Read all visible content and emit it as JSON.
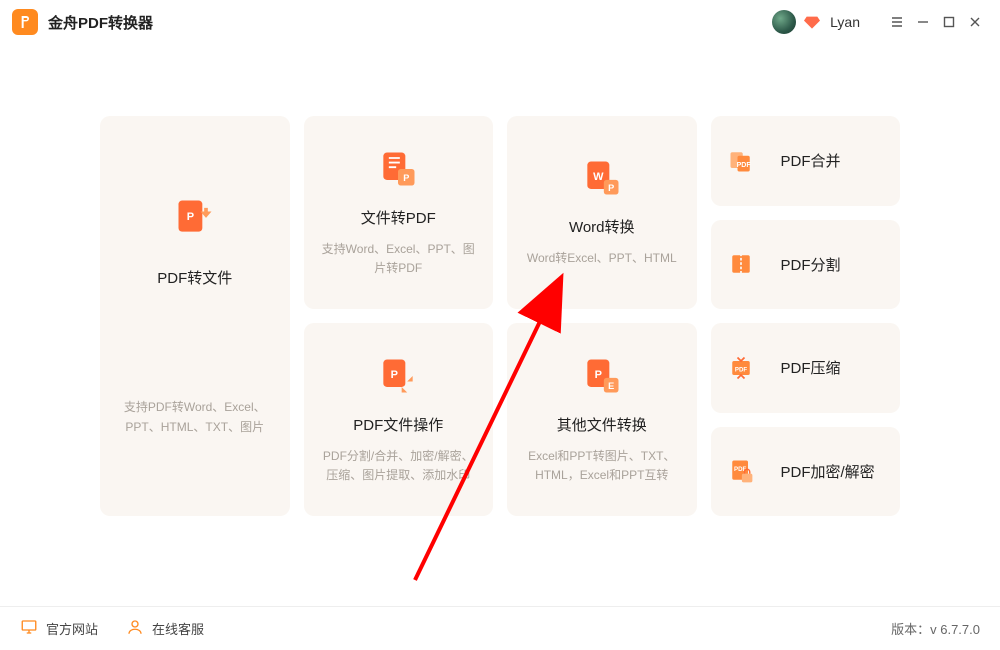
{
  "app": {
    "title": "金舟PDF转换器",
    "username": "Lyan"
  },
  "cards": {
    "pdf2file": {
      "title": "PDF转文件",
      "desc": "支持PDF转Word、Excel、PPT、HTML、TXT、图片"
    },
    "file2pdf": {
      "title": "文件转PDF",
      "desc": "支持Word、Excel、PPT、图片转PDF"
    },
    "pdfops": {
      "title": "PDF文件操作",
      "desc": "PDF分割/合并、加密/解密、压缩、图片提取、添加水印"
    },
    "wordconv": {
      "title": "Word转换",
      "desc": "Word转Excel、PPT、HTML"
    },
    "other": {
      "title": "其他文件转换",
      "desc": "Excel和PPT转图片、TXT、HTML，Excel和PPT互转"
    },
    "merge": {
      "title": "PDF合并"
    },
    "split": {
      "title": "PDF分割"
    },
    "compress": {
      "title": "PDF压缩"
    },
    "encrypt": {
      "title": "PDF加密/解密"
    }
  },
  "footer": {
    "site": "官方网站",
    "support": "在线客服",
    "version_label": "版本：",
    "version": "v 6.7.7.0"
  }
}
